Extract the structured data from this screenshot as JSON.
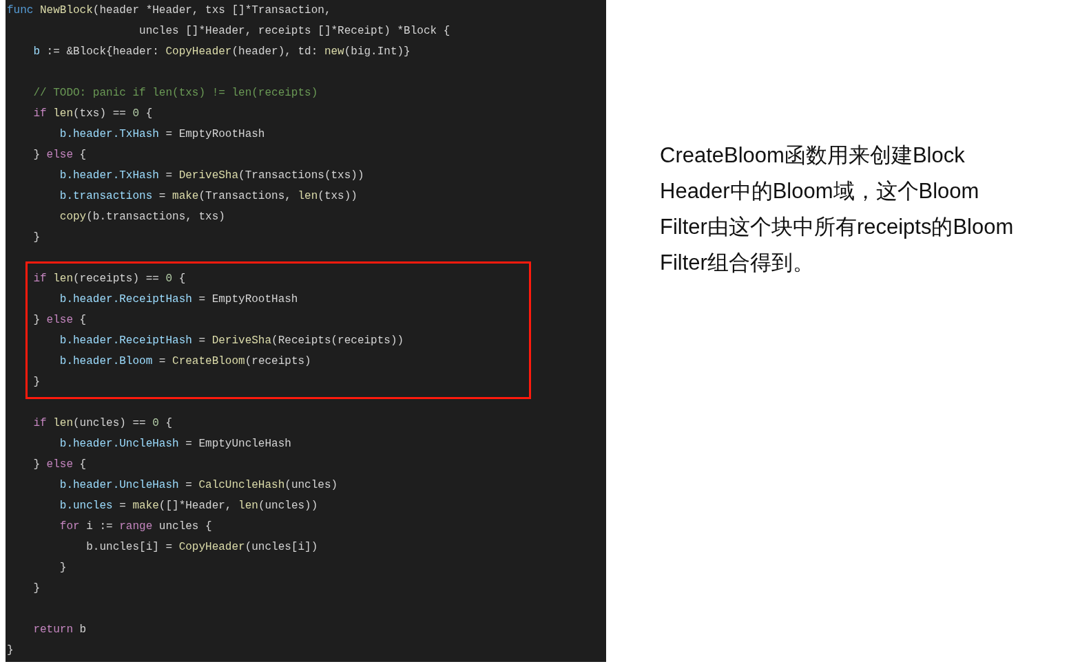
{
  "code": {
    "lines": [
      {
        "kind": "code",
        "tokens": [
          {
            "kind": "keyword",
            "text": "func"
          },
          {
            "kind": "function",
            "text": " NewBlock"
          },
          {
            "kind": "plain",
            "text": "(header *Header, txs []*Transaction,"
          }
        ]
      },
      {
        "kind": "code",
        "tokens": [
          {
            "kind": "plain",
            "text": "                    uncles []*Header, receipts []*Receipt) *Block {"
          }
        ]
      },
      {
        "kind": "code",
        "tokens": [
          {
            "kind": "field",
            "text": "    b"
          },
          {
            "kind": "plain",
            "text": " := &Block{header: "
          },
          {
            "kind": "function",
            "text": "CopyHeader"
          },
          {
            "kind": "plain",
            "text": "(header), td: "
          },
          {
            "kind": "function",
            "text": "new"
          },
          {
            "kind": "plain",
            "text": "(big.Int)}"
          }
        ]
      },
      {
        "kind": "blank"
      },
      {
        "kind": "code",
        "tokens": [
          {
            "kind": "comment",
            "text": "    // TODO: panic if len(txs) != len(receipts)"
          }
        ]
      },
      {
        "kind": "code",
        "tokens": [
          {
            "kind": "control",
            "text": "    if"
          },
          {
            "kind": "function",
            "text": " len"
          },
          {
            "kind": "plain",
            "text": "(txs) == "
          },
          {
            "kind": "number",
            "text": "0"
          },
          {
            "kind": "plain",
            "text": " {"
          }
        ]
      },
      {
        "kind": "code",
        "tokens": [
          {
            "kind": "field",
            "text": "        b.header.TxHash"
          },
          {
            "kind": "plain",
            "text": " = EmptyRootHash"
          }
        ]
      },
      {
        "kind": "code",
        "tokens": [
          {
            "kind": "plain",
            "text": "    } "
          },
          {
            "kind": "control",
            "text": "else"
          },
          {
            "kind": "plain",
            "text": " {"
          }
        ]
      },
      {
        "kind": "code",
        "tokens": [
          {
            "kind": "field",
            "text": "        b.header.TxHash"
          },
          {
            "kind": "plain",
            "text": " = "
          },
          {
            "kind": "function",
            "text": "DeriveSha"
          },
          {
            "kind": "plain",
            "text": "(Transactions(txs))"
          }
        ]
      },
      {
        "kind": "code",
        "tokens": [
          {
            "kind": "field",
            "text": "        b.transactions"
          },
          {
            "kind": "plain",
            "text": " = "
          },
          {
            "kind": "function",
            "text": "make"
          },
          {
            "kind": "plain",
            "text": "(Transactions, "
          },
          {
            "kind": "function",
            "text": "len"
          },
          {
            "kind": "plain",
            "text": "(txs))"
          }
        ]
      },
      {
        "kind": "code",
        "tokens": [
          {
            "kind": "function",
            "text": "        copy"
          },
          {
            "kind": "plain",
            "text": "(b.transactions, txs)"
          }
        ]
      },
      {
        "kind": "code",
        "tokens": [
          {
            "kind": "plain",
            "text": "    }"
          }
        ]
      },
      {
        "kind": "blank"
      },
      {
        "kind": "code",
        "boxed": true,
        "tokens": [
          {
            "kind": "control",
            "text": "    if"
          },
          {
            "kind": "function",
            "text": " len"
          },
          {
            "kind": "plain",
            "text": "(receipts) == "
          },
          {
            "kind": "number",
            "text": "0"
          },
          {
            "kind": "plain",
            "text": " {"
          }
        ]
      },
      {
        "kind": "code",
        "boxed": true,
        "tokens": [
          {
            "kind": "field",
            "text": "        b.header.ReceiptHash"
          },
          {
            "kind": "plain",
            "text": " = EmptyRootHash"
          }
        ]
      },
      {
        "kind": "code",
        "boxed": true,
        "tokens": [
          {
            "kind": "plain",
            "text": "    } "
          },
          {
            "kind": "control",
            "text": "else"
          },
          {
            "kind": "plain",
            "text": " {"
          }
        ]
      },
      {
        "kind": "code",
        "boxed": true,
        "tokens": [
          {
            "kind": "field",
            "text": "        b.header.ReceiptHash"
          },
          {
            "kind": "plain",
            "text": " = "
          },
          {
            "kind": "function",
            "text": "DeriveSha"
          },
          {
            "kind": "plain",
            "text": "(Receipts(receipts))"
          }
        ]
      },
      {
        "kind": "code",
        "boxed": true,
        "tokens": [
          {
            "kind": "field",
            "text": "        b.header.Bloom"
          },
          {
            "kind": "plain",
            "text": " = "
          },
          {
            "kind": "function",
            "text": "CreateBloom"
          },
          {
            "kind": "plain",
            "text": "(receipts)"
          }
        ]
      },
      {
        "kind": "code",
        "boxed": true,
        "tokens": [
          {
            "kind": "plain",
            "text": "    }"
          }
        ]
      },
      {
        "kind": "blank"
      },
      {
        "kind": "code",
        "tokens": [
          {
            "kind": "control",
            "text": "    if"
          },
          {
            "kind": "function",
            "text": " len"
          },
          {
            "kind": "plain",
            "text": "(uncles) == "
          },
          {
            "kind": "number",
            "text": "0"
          },
          {
            "kind": "plain",
            "text": " {"
          }
        ]
      },
      {
        "kind": "code",
        "tokens": [
          {
            "kind": "field",
            "text": "        b.header.UncleHash"
          },
          {
            "kind": "plain",
            "text": " = EmptyUncleHash"
          }
        ]
      },
      {
        "kind": "code",
        "tokens": [
          {
            "kind": "plain",
            "text": "    } "
          },
          {
            "kind": "control",
            "text": "else"
          },
          {
            "kind": "plain",
            "text": " {"
          }
        ]
      },
      {
        "kind": "code",
        "tokens": [
          {
            "kind": "field",
            "text": "        b.header.UncleHash"
          },
          {
            "kind": "plain",
            "text": " = "
          },
          {
            "kind": "function",
            "text": "CalcUncleHash"
          },
          {
            "kind": "plain",
            "text": "(uncles)"
          }
        ]
      },
      {
        "kind": "code",
        "tokens": [
          {
            "kind": "field",
            "text": "        b.uncles"
          },
          {
            "kind": "plain",
            "text": " = "
          },
          {
            "kind": "function",
            "text": "make"
          },
          {
            "kind": "plain",
            "text": "([]*Header, "
          },
          {
            "kind": "function",
            "text": "len"
          },
          {
            "kind": "plain",
            "text": "(uncles))"
          }
        ]
      },
      {
        "kind": "code",
        "tokens": [
          {
            "kind": "control",
            "text": "        for"
          },
          {
            "kind": "plain",
            "text": " i := "
          },
          {
            "kind": "control",
            "text": "range"
          },
          {
            "kind": "plain",
            "text": " uncles {"
          }
        ]
      },
      {
        "kind": "code",
        "tokens": [
          {
            "kind": "plain",
            "text": "            b.uncles[i] = "
          },
          {
            "kind": "function",
            "text": "CopyHeader"
          },
          {
            "kind": "plain",
            "text": "(uncles[i])"
          }
        ]
      },
      {
        "kind": "code",
        "tokens": [
          {
            "kind": "plain",
            "text": "        }"
          }
        ]
      },
      {
        "kind": "code",
        "tokens": [
          {
            "kind": "plain",
            "text": "    }"
          }
        ]
      },
      {
        "kind": "blank"
      },
      {
        "kind": "code",
        "tokens": [
          {
            "kind": "control",
            "text": "    return"
          },
          {
            "kind": "plain",
            "text": " b"
          }
        ]
      },
      {
        "kind": "code",
        "tokens": [
          {
            "kind": "plain",
            "text": "}"
          }
        ]
      }
    ]
  },
  "explanation_lines": [
    "CreateBloom函数用来创建Block",
    "Header中的Bloom域，这个Bloom",
    "Filter由这个块中所有receipts的Bloom",
    "Filter组合得到。"
  ]
}
